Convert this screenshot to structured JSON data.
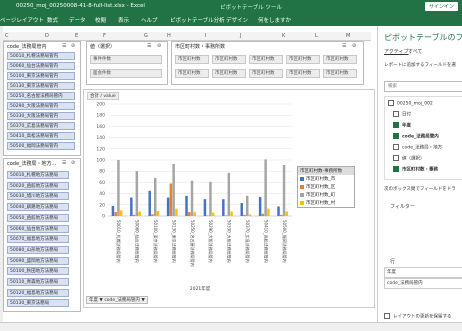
{
  "titlebar": {
    "title": "00250_moj_00250008-41-8-full-list.xlsx - Excel",
    "pivot_tools": "ピボットテーブル ツール",
    "signin": "サインイン"
  },
  "tabs": [
    "ページレイアウト",
    "数式",
    "データ",
    "校閲",
    "表示",
    "ヘルプ",
    "ピボットテーブル分析",
    "デザイン",
    "何をしますか"
  ],
  "columns": [
    "C",
    "D",
    "E",
    "F",
    "G",
    "H",
    "I",
    "J",
    "K",
    "L",
    "M"
  ],
  "slicer_left1": {
    "title": "code_法務局管内",
    "items": [
      "50010_札幌法務局管内",
      "50060_仙台法務局管内",
      "50100_東京法務局管内",
      "50130_東京法務局管内",
      "50250_名古屋法務局管内",
      "50290_大阪法務局管内",
      "50330_大阪法務局管内",
      "50370_広島法務局管内",
      "50410_高松法務局管内",
      "50500_福岡法務局管内"
    ]
  },
  "slicer_left2": {
    "title": "code_法務局・地方...",
    "items": [
      "50010_札幌地方法務局",
      "50020_函館地方法務局",
      "50030_旭川地方法務局",
      "50040_釧路地方法務局",
      "50050_函館地方法務局",
      "50060_仙台地方法務局",
      "50070_福島地方法務局",
      "50080_山形地方法務局",
      "50090_盛岡地方法務局",
      "50100_秋田地方法務局",
      "50110_青森地方法務局",
      "50120_福島地方法務局",
      "50130_東京法務局"
    ]
  },
  "slicer_year": {
    "title": "値（選択）",
    "items": [
      "事件件数",
      "面会件数"
    ]
  },
  "slicer_city": {
    "title": "市区町村数・事務所数",
    "items": [
      "市区町村数",
      "市区町村数",
      "市区町村数",
      "市区町村数",
      "市区町村数",
      "市区町村数",
      "市区町村数",
      "市区町村数",
      "市区町村数",
      "市区町村数"
    ]
  },
  "chart_tag": "合計 / value",
  "chart_data": {
    "type": "bar",
    "categories": [
      "50010_札幌法務局管内",
      "50060_仙台法務局管内",
      "50100_東京法務局管内",
      "50130_東京法務局管内",
      "50250_名古屋法務局管内",
      "50290_大阪法務局管内",
      "50330_大阪法務局管内",
      "50370_広島法務局管内",
      "50410_高松法務局管内",
      "50500_福岡法務局管内"
    ],
    "series": [
      {
        "name": "市区町村数_市",
        "color": "#4472c4",
        "values": [
          18,
          33,
          45,
          33,
          36,
          30,
          30,
          23,
          34,
          17
        ]
      },
      {
        "name": "市区町村数_区",
        "color": "#ed7d31",
        "values": [
          7,
          2,
          3,
          58,
          7,
          1,
          1,
          2,
          4,
          2
        ]
      },
      {
        "name": "市区町村数_町",
        "color": "#a5a5a5",
        "values": [
          100,
          80,
          68,
          93,
          63,
          61,
          77,
          36,
          101,
          91
        ]
      },
      {
        "name": "市区町村数_村",
        "color": "#ffc000",
        "values": [
          10,
          8,
          9,
          13,
          7,
          6,
          8,
          3,
          13,
          8
        ]
      }
    ],
    "xlabel": "2021年度",
    "ylim": [
      0,
      200
    ],
    "yticks": [
      0,
      20,
      40,
      60,
      80,
      100,
      120,
      140,
      160,
      180,
      200
    ],
    "legend_title": "市区町村数-事務所数",
    "legend_placement": "right"
  },
  "filter_label": "年度 ▼  code_法務局管内 ▼",
  "pane": {
    "title": "ピボットテーブルのフ",
    "tab_active": "アクティブ",
    "tab_all": "すべて",
    "instruction": "レポートに追加するフィールドを選",
    "search_placeholder": "検索",
    "fields": [
      {
        "label": "00250_moj_002",
        "checked": false
      },
      {
        "label": "日付",
        "checked": false
      },
      {
        "label": "年度",
        "checked": true
      },
      {
        "label": "code_法務局管内",
        "checked": true
      },
      {
        "label": "code_法務局・地方",
        "checked": false
      },
      {
        "label": "値（選択）",
        "checked": false
      },
      {
        "label": "市区町村数・事務",
        "checked": true
      }
    ],
    "drag_hint": "次のボックス間でフィールドをドラ",
    "filter_section": "フィルター",
    "rows_section": "行",
    "row_items": [
      "年度",
      "code_法務局管内"
    ],
    "defer": "レイアウトの更新を保留する"
  }
}
